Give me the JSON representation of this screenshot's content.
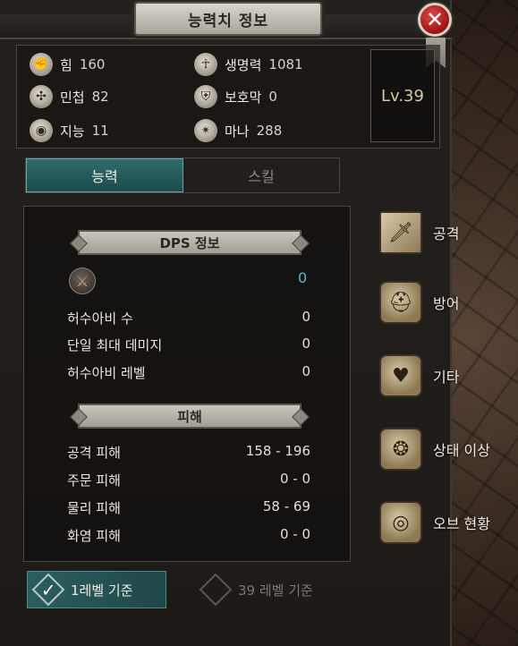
{
  "window": {
    "title": "능력치 정보",
    "close_symbol": "✕"
  },
  "stats": {
    "strength": {
      "label": "힘",
      "value": "160"
    },
    "agility": {
      "label": "민첩",
      "value": "82"
    },
    "intelligence": {
      "label": "지능",
      "value": "11"
    },
    "life": {
      "label": "생명력",
      "value": "1081"
    },
    "shield": {
      "label": "보호막",
      "value": "0"
    },
    "mana": {
      "label": "마나",
      "value": "288"
    }
  },
  "level": "Lv.39",
  "tabs": [
    {
      "label": "능력",
      "active": true
    },
    {
      "label": "스킬",
      "active": false
    }
  ],
  "dps": {
    "header": "DPS 정보",
    "value": "0",
    "rows": [
      {
        "label": "허수아비 수",
        "value": "0"
      },
      {
        "label": "단일 최대 데미지",
        "value": "0"
      },
      {
        "label": "허수아비 레벨",
        "value": "0"
      }
    ]
  },
  "damage": {
    "header": "피해",
    "rows": [
      {
        "label": "공격 피해",
        "value": "158 - 196"
      },
      {
        "label": "주문 피해",
        "value": "0 - 0"
      },
      {
        "label": "물리 피해",
        "value": "58 - 69"
      },
      {
        "label": "화염 피해",
        "value": "0 - 0"
      }
    ]
  },
  "side_menu": [
    {
      "label": "공격",
      "icon": "sword-icon"
    },
    {
      "label": "방어",
      "icon": "helmet-icon"
    },
    {
      "label": "기타",
      "icon": "heart-icon"
    },
    {
      "label": "상태 이상",
      "icon": "status-icon"
    },
    {
      "label": "오브 현황",
      "icon": "orb-icon"
    }
  ],
  "options": {
    "level1": {
      "label": "1레벨 기준",
      "checked": true
    },
    "level39": {
      "label": "39 레벨 기준",
      "checked": false
    }
  },
  "colors": {
    "accent_teal": "#2f6d6c",
    "dps_value": "#5bb7d8",
    "close_red": "#c82424"
  }
}
